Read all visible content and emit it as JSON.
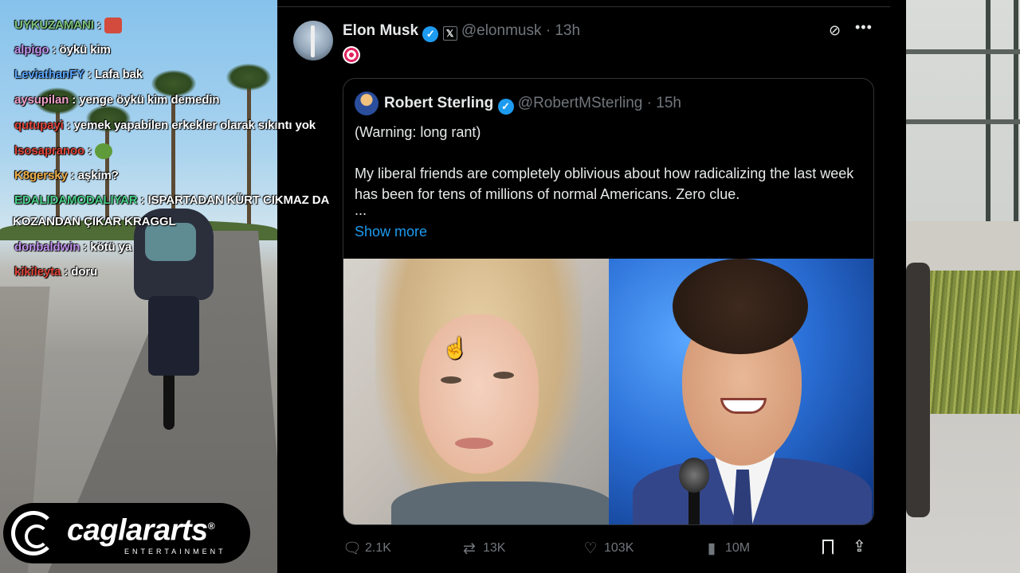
{
  "chat": {
    "messages": [
      {
        "user": "UYKUZAMANI",
        "user_color": "#7cc47a",
        "text": ":",
        "emote": "angry-face-emote"
      },
      {
        "user": "alpigo",
        "user_color": "#c495f0",
        "text": ": öykü kim"
      },
      {
        "user": "LeviathanFY",
        "user_color": "#5aa6ff",
        "text": ": Lafa bak"
      },
      {
        "user": "aysupilan",
        "user_color": "#f0a0c8",
        "text": ": yenge öykü kim demedin"
      },
      {
        "user": "qutupayi",
        "user_color": "#e0463b",
        "text": ": yemek yapabilen erkekler olarak sıkıntı yok"
      },
      {
        "user": "lsosapranoo",
        "user_color": "#e0463b",
        "text": ":",
        "emote": "pepe-frog-emote"
      },
      {
        "user": "K8gersky",
        "user_color": "#f0b04a",
        "text": ": aşkim?"
      },
      {
        "user": "EDALIDAMODALIYAR",
        "user_color": "#4ad08a",
        "text": ": ISPARTADAN KÜRT CIKMAZ DA"
      },
      {
        "user": "",
        "user_color": "#ffffff",
        "text": "KOZANDAN ÇIKAR KRAGGL"
      },
      {
        "user": "donbaldwin",
        "user_color": "#c495f0",
        "text": ": kötü ya"
      },
      {
        "user": "kikileyta",
        "user_color": "#e0463b",
        "text": ": doru"
      }
    ]
  },
  "logo": {
    "name": "caglararts",
    "registered": "®",
    "sub": "ENTERTAINMENT"
  },
  "tweet": {
    "author_name": "Elon Musk",
    "verified_mark": "✓",
    "affiliate_badge": "𝕏",
    "handle_time": "@elonmusk · 13h",
    "grok_icon": "⊘",
    "more_icon": "•••",
    "quoted": {
      "author_name": "Robert Sterling",
      "verified_mark": "✓",
      "handle_time": "@RobertMSterling · 15h",
      "text_line1": "(Warning: long rant)",
      "text_line2": "My liberal friends are completely oblivious about how radicalizing the last week has been for tens of millions of normal Americans. Zero clue.",
      "ellipsis": "...",
      "show_more": "Show more"
    },
    "actions": {
      "replies": "2.1K",
      "reposts": "13K",
      "likes": "103K",
      "views": "10M",
      "reply_icon": "🗨",
      "repost_icon": "⇄",
      "like_icon": "♡",
      "views_icon": "▮",
      "share_icon": "⇪"
    },
    "cursor": "☝"
  },
  "colors": {
    "accent_blue": "#1d9bf0",
    "panel_bg": "#000000",
    "muted_text": "#71767b",
    "primary_text": "#e7e9ea"
  }
}
